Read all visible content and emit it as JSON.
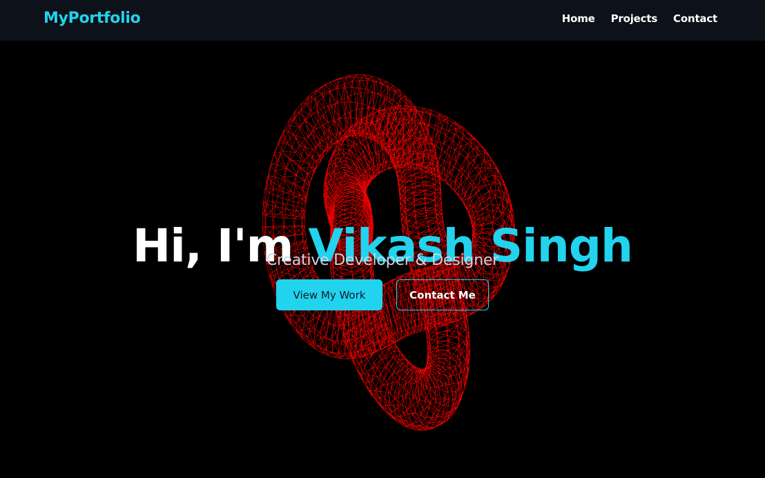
{
  "nav": {
    "brand": "MyPortfolio",
    "links": [
      {
        "label": "Home"
      },
      {
        "label": "Projects"
      },
      {
        "label": "Contact"
      }
    ]
  },
  "hero": {
    "greeting": "Hi, I'm",
    "name": "Vikash Singh",
    "subtitle": "Creative Developer & Designer",
    "primary_button": "View My Work",
    "secondary_button": "Contact Me"
  },
  "colors": {
    "accent": "#22d3ee",
    "navbar_bg": "#0d111a",
    "page_bg": "#000000",
    "wireframe": "#ff0000"
  }
}
